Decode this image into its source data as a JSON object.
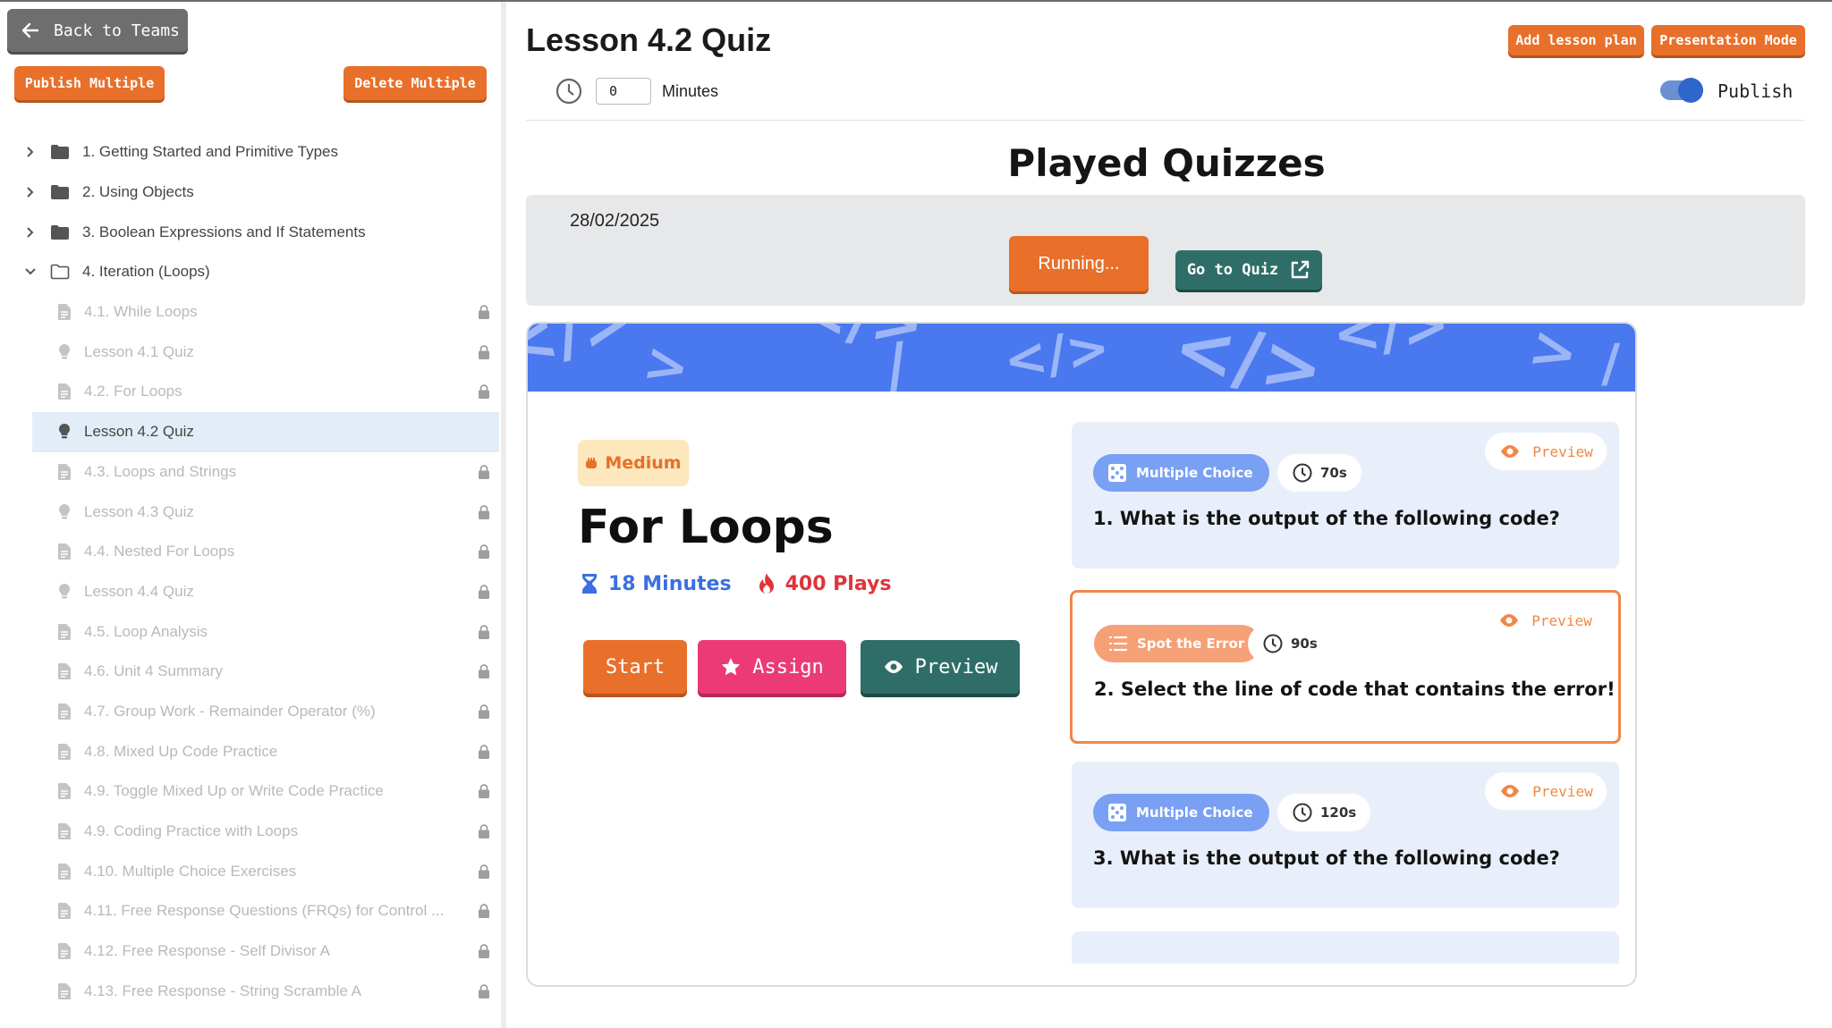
{
  "sidebar": {
    "back_label": "Back to Teams",
    "publish_multiple": "Publish Multiple",
    "delete_multiple": "Delete Multiple",
    "units": [
      {
        "label": "1. Getting Started and Primitive Types"
      },
      {
        "label": "2. Using Objects"
      },
      {
        "label": "3. Boolean Expressions and If Statements"
      },
      {
        "label": "4. Iteration (Loops)"
      }
    ],
    "lessons": [
      {
        "label": "4.1. While Loops",
        "kind": "doc"
      },
      {
        "label": "Lesson 4.1 Quiz",
        "kind": "quiz"
      },
      {
        "label": "4.2. For Loops",
        "kind": "doc"
      },
      {
        "label": "Lesson 4.2 Quiz",
        "kind": "quiz",
        "active": true
      },
      {
        "label": "4.3. Loops and Strings",
        "kind": "doc"
      },
      {
        "label": "Lesson 4.3 Quiz",
        "kind": "quiz"
      },
      {
        "label": "4.4. Nested For Loops",
        "kind": "doc"
      },
      {
        "label": "Lesson 4.4 Quiz",
        "kind": "quiz"
      },
      {
        "label": "4.5. Loop Analysis",
        "kind": "doc"
      },
      {
        "label": "4.6. Unit 4 Summary",
        "kind": "doc"
      },
      {
        "label": "4.7. Group Work - Remainder Operator (%)",
        "kind": "doc"
      },
      {
        "label": "4.8. Mixed Up Code Practice",
        "kind": "doc"
      },
      {
        "label": "4.9. Toggle Mixed Up or Write Code Practice",
        "kind": "doc"
      },
      {
        "label": "4.9. Coding Practice with Loops",
        "kind": "doc"
      },
      {
        "label": "4.10. Multiple Choice Exercises",
        "kind": "doc"
      },
      {
        "label": "4.11. Free Response Questions (FRQs) for Control ...",
        "kind": "doc"
      },
      {
        "label": "4.12. Free Response - Self Divisor A",
        "kind": "doc"
      },
      {
        "label": "4.13. Free Response - String Scramble A",
        "kind": "doc"
      }
    ]
  },
  "header": {
    "title": "Lesson 4.2 Quiz",
    "add_lesson_plan": "Add lesson plan",
    "presentation_mode": "Presentation Mode",
    "minutes_value": "0",
    "minutes_label": "Minutes",
    "publish_label": "Publish",
    "publish_on": true
  },
  "played": {
    "title": "Played Quizzes",
    "date": "28/02/2025",
    "running_label": "Running...",
    "go_to_quiz": "Go to Quiz"
  },
  "quiz": {
    "difficulty": "Medium",
    "title": "For Loops",
    "duration": "18 Minutes",
    "plays": "400 Plays",
    "start": "Start",
    "assign": "Assign",
    "preview": "Preview",
    "questions": [
      {
        "type": "Multiple Choice",
        "time": "70s",
        "preview": "Preview",
        "text": "1. What is the output of the following code?"
      },
      {
        "type": "Spot the Error",
        "time": "90s",
        "preview": "Preview",
        "text": "2. Select the line of code that contains the error!"
      },
      {
        "type": "Multiple Choice",
        "time": "120s",
        "preview": "Preview",
        "text": "3. What is the output of the following code?"
      }
    ]
  },
  "colors": {
    "accent_orange": "#e8702a",
    "teal": "#2f6e68",
    "pink": "#ec3a76",
    "banner_blue": "#4978ef"
  }
}
